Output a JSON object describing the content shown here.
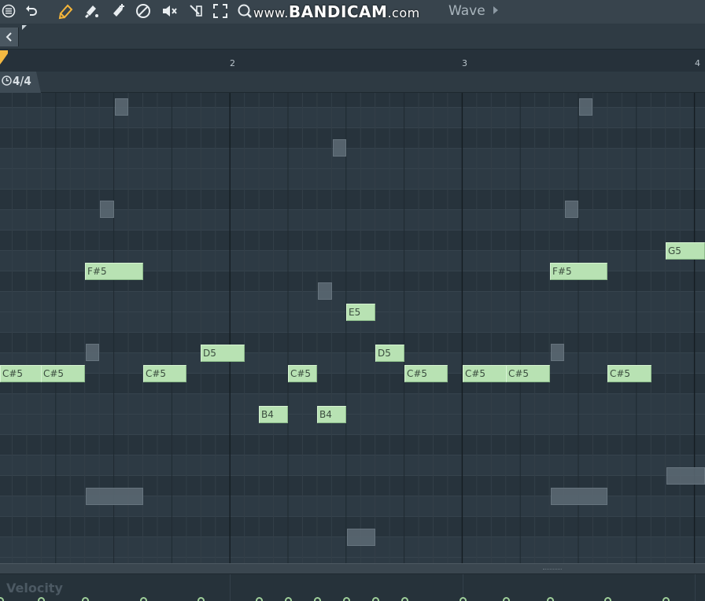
{
  "watermark": {
    "www": "www.",
    "brand": "BANDICAM",
    "tld": ".com"
  },
  "channel": {
    "name": "Wave"
  },
  "toolbar_icons": [
    "menu-icon",
    "undo-icon",
    "pencil-icon",
    "paint-icon",
    "stamp-icon",
    "delete-icon",
    "mute-icon",
    "slice-icon",
    "select-icon",
    "zoom-icon"
  ],
  "ruler": {
    "bars": [
      "2",
      "3",
      "4"
    ]
  },
  "time_signature": "4/4",
  "notes": [
    {
      "label": "C#5"
    },
    {
      "label": "C#5"
    },
    {
      "label": "F#5"
    },
    {
      "label": "C#5"
    },
    {
      "label": "D5"
    },
    {
      "label": "B4"
    },
    {
      "label": "C#5"
    },
    {
      "label": "B4"
    },
    {
      "label": "E5"
    },
    {
      "label": "D5"
    },
    {
      "label": "C#5"
    },
    {
      "label": "C#5"
    },
    {
      "label": "C#5"
    },
    {
      "label": "F#5"
    },
    {
      "label": "C#5"
    },
    {
      "label": "G5"
    }
  ],
  "velocity": {
    "label": "Velocity"
  },
  "colors": {
    "note_fill": "#b8e2b3",
    "grid_bg": "#2a3640",
    "ghost_note": "#5a6872",
    "velocity_dot": "#9fd09a"
  }
}
